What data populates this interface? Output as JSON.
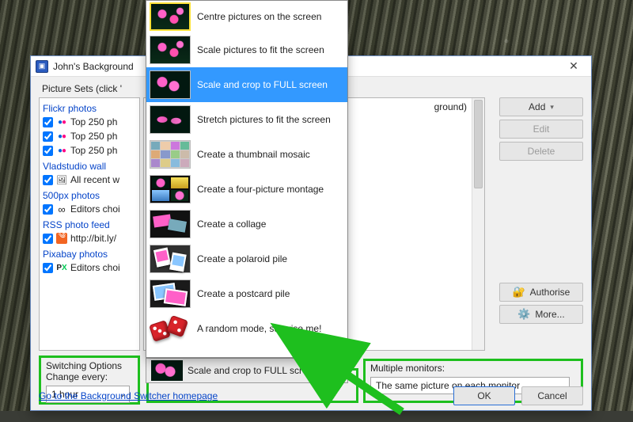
{
  "window": {
    "title": "John's Background",
    "close": "✕"
  },
  "instruction_prefix": "Picture Sets (click '",
  "instruction_suffix": "ground)",
  "tree": {
    "categories": [
      {
        "label": "Flickr photos",
        "items": [
          {
            "label": "Top 250 ph",
            "icon": "flickr"
          },
          {
            "label": "Top 250 ph",
            "icon": "flickr"
          },
          {
            "label": "Top 250 ph",
            "icon": "flickr"
          }
        ]
      },
      {
        "label": "Vladstudio wall",
        "items": [
          {
            "label": "All recent w",
            "icon": "vlad"
          }
        ]
      },
      {
        "label": "500px photos",
        "items": [
          {
            "label": "Editors choi",
            "icon": "inf"
          }
        ]
      },
      {
        "label": "RSS photo feed",
        "items": [
          {
            "label": "http://bit.ly/",
            "icon": "rss"
          }
        ]
      },
      {
        "label": "Pixabay photos",
        "items": [
          {
            "label": "Editors choi",
            "icon": "px"
          }
        ]
      }
    ]
  },
  "buttons": {
    "add": "Add",
    "edit": "Edit",
    "delete": "Delete",
    "authorise": "Authorise",
    "more": "More..."
  },
  "switching": {
    "title": "Switching Options",
    "label": "Change every:",
    "value": "1 hour"
  },
  "mode": {
    "selected": "Scale and crop to FULL screen",
    "options": [
      "Centre pictures on the screen",
      "Scale pictures to fit the screen",
      "Scale and crop to FULL screen",
      "Stretch pictures to fit the screen",
      "Create a thumbnail mosaic",
      "Create a four-picture montage",
      "Create a collage",
      "Create a polaroid pile",
      "Create a postcard pile",
      "A random mode, surprise me!"
    ]
  },
  "monitors": {
    "label": "Multiple monitors:",
    "value": "The same picture on each monitor"
  },
  "footer": {
    "link": "Go to the Background Switcher homepage",
    "ok": "OK",
    "cancel": "Cancel"
  }
}
